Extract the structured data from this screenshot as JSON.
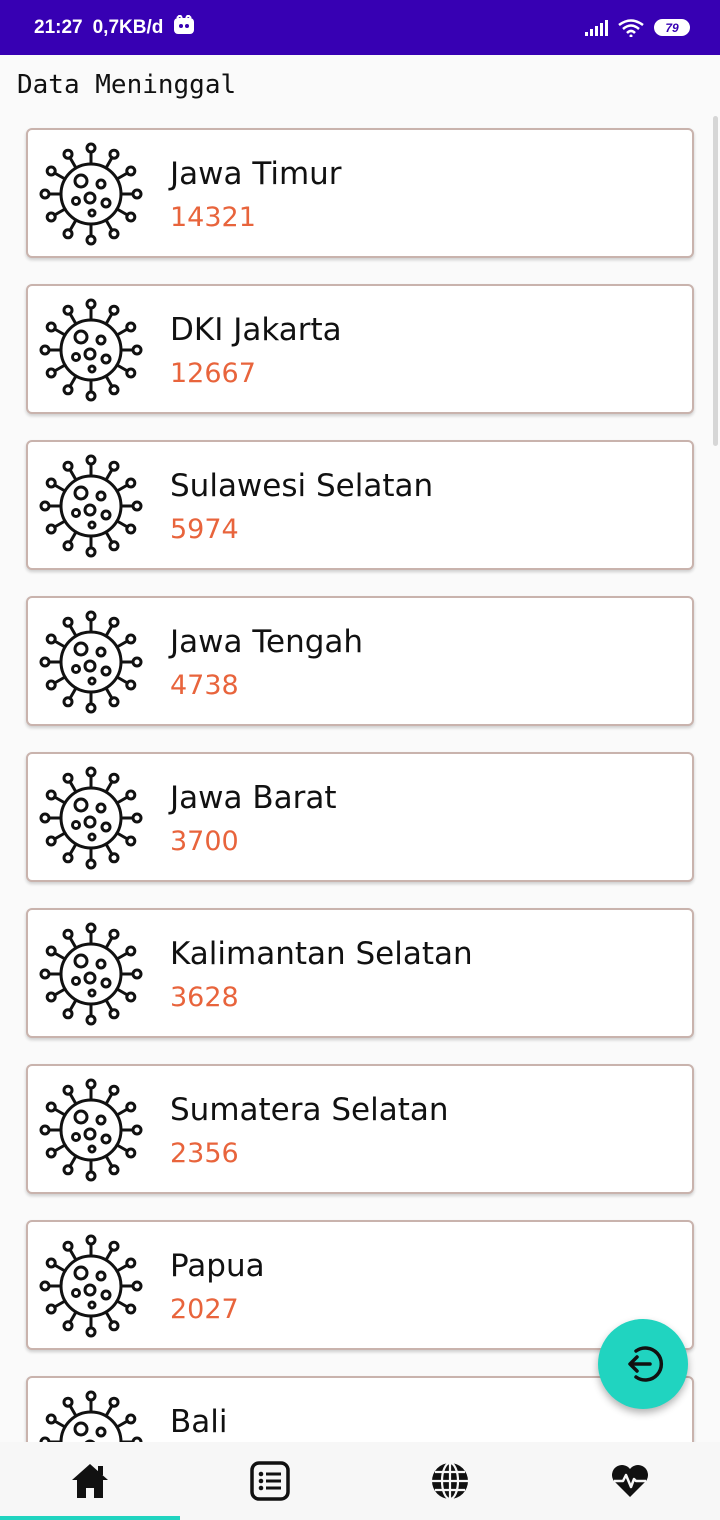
{
  "status_bar": {
    "time": "21:27",
    "speed": "0,7KB/d",
    "battery": "79"
  },
  "page": {
    "title": "Data Meninggal"
  },
  "provinces": [
    {
      "name": "Jawa Timur",
      "count": "14321"
    },
    {
      "name": "DKI Jakarta",
      "count": "12667"
    },
    {
      "name": "Sulawesi Selatan",
      "count": "5974"
    },
    {
      "name": "Jawa Tengah",
      "count": "4738"
    },
    {
      "name": "Jawa Barat",
      "count": "3700"
    },
    {
      "name": "Kalimantan Selatan",
      "count": "3628"
    },
    {
      "name": "Sumatera Selatan",
      "count": "2356"
    },
    {
      "name": "Papua",
      "count": "2027"
    },
    {
      "name": "Bali",
      "count": ""
    }
  ],
  "colors": {
    "status_bar": "#3700b3",
    "count_text": "#e8643c",
    "accent": "#20d4c0"
  },
  "bottom_nav": [
    {
      "icon": "home-icon",
      "active": true
    },
    {
      "icon": "list-icon",
      "active": false
    },
    {
      "icon": "globe-icon",
      "active": false
    },
    {
      "icon": "heartbeat-icon",
      "active": false
    }
  ],
  "fab": {
    "icon": "logout-icon"
  }
}
